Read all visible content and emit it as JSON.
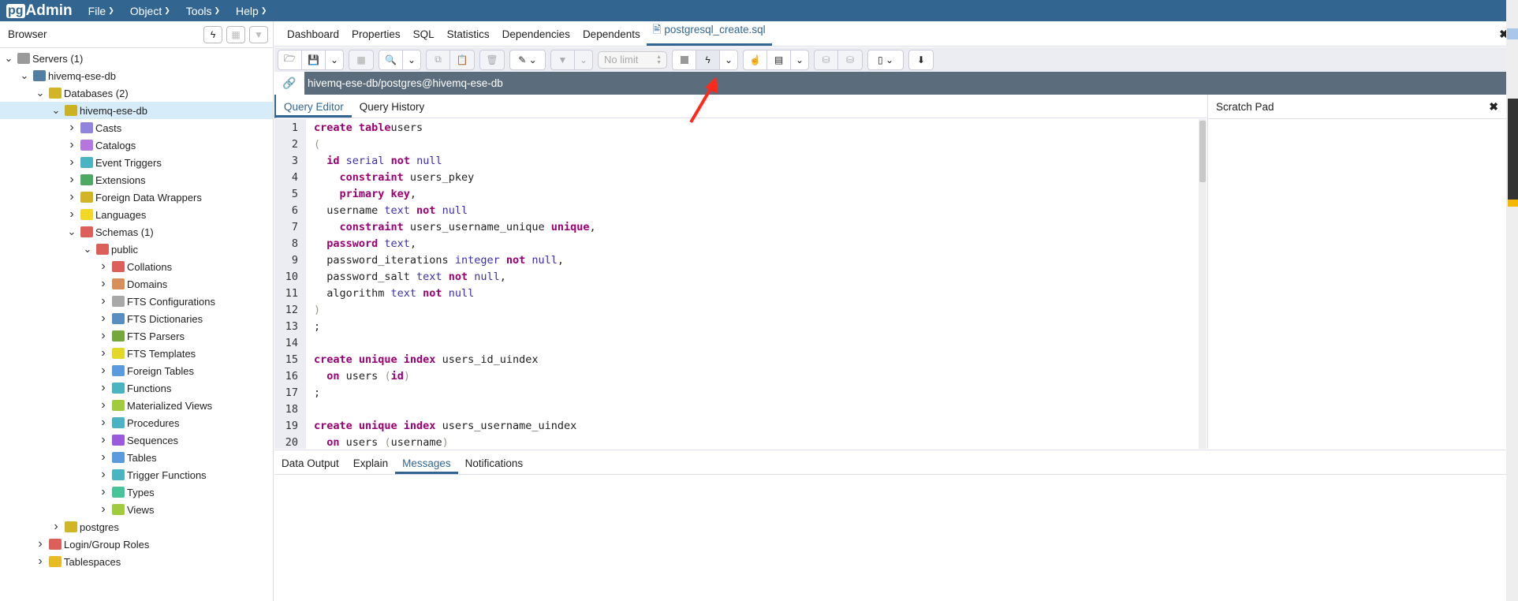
{
  "app": {
    "logo_prefix": "pg",
    "logo_suffix": "Admin"
  },
  "menu": [
    {
      "label": "File"
    },
    {
      "label": "Object"
    },
    {
      "label": "Tools"
    },
    {
      "label": "Help"
    }
  ],
  "browser": {
    "title": "Browser",
    "tools": [
      {
        "icon": "query-tool-icon"
      },
      {
        "icon": "view-data-icon"
      },
      {
        "icon": "filter-icon"
      }
    ],
    "tree": [
      {
        "label": "Servers (1)",
        "depth": 0,
        "expanded": true,
        "icon": "servers-icon",
        "color": "#888"
      },
      {
        "label": "hivemq-ese-db",
        "depth": 1,
        "expanded": true,
        "icon": "postgres-server-icon",
        "color": "#336791"
      },
      {
        "label": "Databases (2)",
        "depth": 2,
        "expanded": true,
        "icon": "databases-icon",
        "color": "#c9a800"
      },
      {
        "label": "hivemq-ese-db",
        "depth": 3,
        "expanded": true,
        "selected": true,
        "icon": "database-icon",
        "color": "#c9a800"
      },
      {
        "label": "Casts",
        "depth": 4,
        "expanded": false,
        "icon": "casts-icon",
        "color": "#7e6fd6"
      },
      {
        "label": "Catalogs",
        "depth": 4,
        "expanded": false,
        "icon": "catalogs-icon",
        "color": "#a85fd6"
      },
      {
        "label": "Event Triggers",
        "depth": 4,
        "expanded": false,
        "icon": "event-triggers-icon",
        "color": "#2aa7b9"
      },
      {
        "label": "Extensions",
        "depth": 4,
        "expanded": false,
        "icon": "extensions-icon",
        "color": "#2f9a4a"
      },
      {
        "label": "Foreign Data Wrappers",
        "depth": 4,
        "expanded": false,
        "icon": "foreign-data-wrappers-icon",
        "color": "#c9a800"
      },
      {
        "label": "Languages",
        "depth": 4,
        "expanded": false,
        "icon": "languages-icon",
        "color": "#f0d000"
      },
      {
        "label": "Schemas (1)",
        "depth": 4,
        "expanded": true,
        "icon": "schemas-icon",
        "color": "#d6443c"
      },
      {
        "label": "public",
        "depth": 5,
        "expanded": true,
        "icon": "schema-icon",
        "color": "#d6443c"
      },
      {
        "label": "Collations",
        "depth": 6,
        "expanded": false,
        "icon": "collations-icon",
        "color": "#d6443c"
      },
      {
        "label": "Domains",
        "depth": 6,
        "expanded": false,
        "icon": "domains-icon",
        "color": "#d07a3c"
      },
      {
        "label": "FTS Configurations",
        "depth": 6,
        "expanded": false,
        "icon": "fts-configurations-icon",
        "color": "#999"
      },
      {
        "label": "FTS Dictionaries",
        "depth": 6,
        "expanded": false,
        "icon": "fts-dictionaries-icon",
        "color": "#3c7ab9"
      },
      {
        "label": "FTS Parsers",
        "depth": 6,
        "expanded": false,
        "icon": "fts-parsers-icon",
        "color": "#5a9a1a"
      },
      {
        "label": "FTS Templates",
        "depth": 6,
        "expanded": false,
        "icon": "fts-templates-icon",
        "color": "#e0d000"
      },
      {
        "label": "Foreign Tables",
        "depth": 6,
        "expanded": false,
        "icon": "foreign-tables-icon",
        "color": "#3c8ad6"
      },
      {
        "label": "Functions",
        "depth": 6,
        "expanded": false,
        "icon": "functions-icon",
        "color": "#2aa7b9"
      },
      {
        "label": "Materialized Views",
        "depth": 6,
        "expanded": false,
        "icon": "materialized-views-icon",
        "color": "#8fc21a"
      },
      {
        "label": "Procedures",
        "depth": 6,
        "expanded": false,
        "icon": "procedures-icon",
        "color": "#2aa7b9"
      },
      {
        "label": "Sequences",
        "depth": 6,
        "expanded": false,
        "icon": "sequences-icon",
        "color": "#8a3cd6"
      },
      {
        "label": "Tables",
        "depth": 6,
        "expanded": false,
        "icon": "tables-icon",
        "color": "#3c8ad6"
      },
      {
        "label": "Trigger Functions",
        "depth": 6,
        "expanded": false,
        "icon": "trigger-functions-icon",
        "color": "#2aa7b9"
      },
      {
        "label": "Types",
        "depth": 6,
        "expanded": false,
        "icon": "types-icon",
        "color": "#2ab98a"
      },
      {
        "label": "Views",
        "depth": 6,
        "expanded": false,
        "icon": "views-icon",
        "color": "#8fc21a"
      },
      {
        "label": "postgres",
        "depth": 3,
        "expanded": false,
        "icon": "database-icon",
        "color": "#c9a800"
      },
      {
        "label": "Login/Group Roles",
        "depth": 2,
        "expanded": false,
        "icon": "login-group-roles-icon",
        "color": "#d6443c"
      },
      {
        "label": "Tablespaces",
        "depth": 2,
        "expanded": false,
        "icon": "tablespaces-icon",
        "color": "#e0b000"
      }
    ]
  },
  "tabs": [
    {
      "label": "Dashboard"
    },
    {
      "label": "Properties"
    },
    {
      "label": "SQL"
    },
    {
      "label": "Statistics"
    },
    {
      "label": "Dependencies"
    },
    {
      "label": "Dependents"
    },
    {
      "label": "postgresql_create.sql",
      "active": true,
      "icon": "file-icon"
    }
  ],
  "toolbar": {
    "limit_placeholder": "No limit"
  },
  "connection": {
    "label": "hivemq-ese-db/postgres@hivemq-ese-db"
  },
  "query_tabs": [
    {
      "label": "Query Editor",
      "active": true
    },
    {
      "label": "Query History"
    }
  ],
  "scratch_pad": {
    "title": "Scratch Pad"
  },
  "editor": {
    "lines": [
      [
        [
          "kw",
          "create table"
        ],
        [
          "",
          "users"
        ]
      ],
      [
        [
          "br",
          "("
        ]
      ],
      [
        [
          "",
          "  "
        ],
        [
          "kw",
          "id"
        ],
        [
          "ty",
          " serial"
        ],
        [
          "kw",
          " not"
        ],
        [
          "ty",
          " null"
        ]
      ],
      [
        [
          "",
          "    "
        ],
        [
          "kw",
          "constraint"
        ],
        [
          "",
          " users_pkey"
        ]
      ],
      [
        [
          "",
          "    "
        ],
        [
          "kw",
          "primary key"
        ],
        [
          "",
          ","
        ]
      ],
      [
        [
          "",
          "  username"
        ],
        [
          "ty",
          " text"
        ],
        [
          "kw",
          " not"
        ],
        [
          "ty",
          " null"
        ]
      ],
      [
        [
          "",
          "    "
        ],
        [
          "kw",
          "constraint"
        ],
        [
          "",
          " users_username_unique "
        ],
        [
          "kw",
          "unique"
        ],
        [
          "",
          ","
        ]
      ],
      [
        [
          "",
          "  "
        ],
        [
          "kw",
          "password"
        ],
        [
          "ty",
          " text"
        ],
        [
          "",
          ","
        ]
      ],
      [
        [
          "",
          "  password_iterations"
        ],
        [
          "ty",
          " integer"
        ],
        [
          "kw",
          " not"
        ],
        [
          "ty",
          " null"
        ],
        [
          "",
          ","
        ]
      ],
      [
        [
          "",
          "  password_salt"
        ],
        [
          "ty",
          " text"
        ],
        [
          "kw",
          " not"
        ],
        [
          "ty",
          " null"
        ],
        [
          "",
          ","
        ]
      ],
      [
        [
          "",
          "  algorithm"
        ],
        [
          "ty",
          " text"
        ],
        [
          "kw",
          " not"
        ],
        [
          "ty",
          " null"
        ]
      ],
      [
        [
          "br",
          ")"
        ]
      ],
      [
        [
          "",
          ";"
        ]
      ],
      [
        [
          "",
          ""
        ]
      ],
      [
        [
          "kw",
          "create unique index"
        ],
        [
          "",
          " users_id_uindex"
        ]
      ],
      [
        [
          "",
          "  "
        ],
        [
          "kw",
          "on"
        ],
        [
          "",
          " users "
        ],
        [
          "br",
          "("
        ],
        [
          "kw",
          "id"
        ],
        [
          "br",
          ")"
        ]
      ],
      [
        [
          "",
          ";"
        ]
      ],
      [
        [
          "",
          ""
        ]
      ],
      [
        [
          "kw",
          "create unique index"
        ],
        [
          "",
          " users_username_uindex"
        ]
      ],
      [
        [
          "",
          "  "
        ],
        [
          "kw",
          "on"
        ],
        [
          "",
          " users "
        ],
        [
          "br",
          "("
        ],
        [
          "",
          "username"
        ],
        [
          "br",
          ")"
        ]
      ]
    ]
  },
  "output_tabs": [
    {
      "label": "Data Output"
    },
    {
      "label": "Explain"
    },
    {
      "label": "Messages",
      "active": true
    },
    {
      "label": "Notifications"
    }
  ],
  "colors": {
    "brand": "#326690",
    "connection_bar": "#5b6d7c",
    "annotation_arrow": "#ff2a1a"
  }
}
